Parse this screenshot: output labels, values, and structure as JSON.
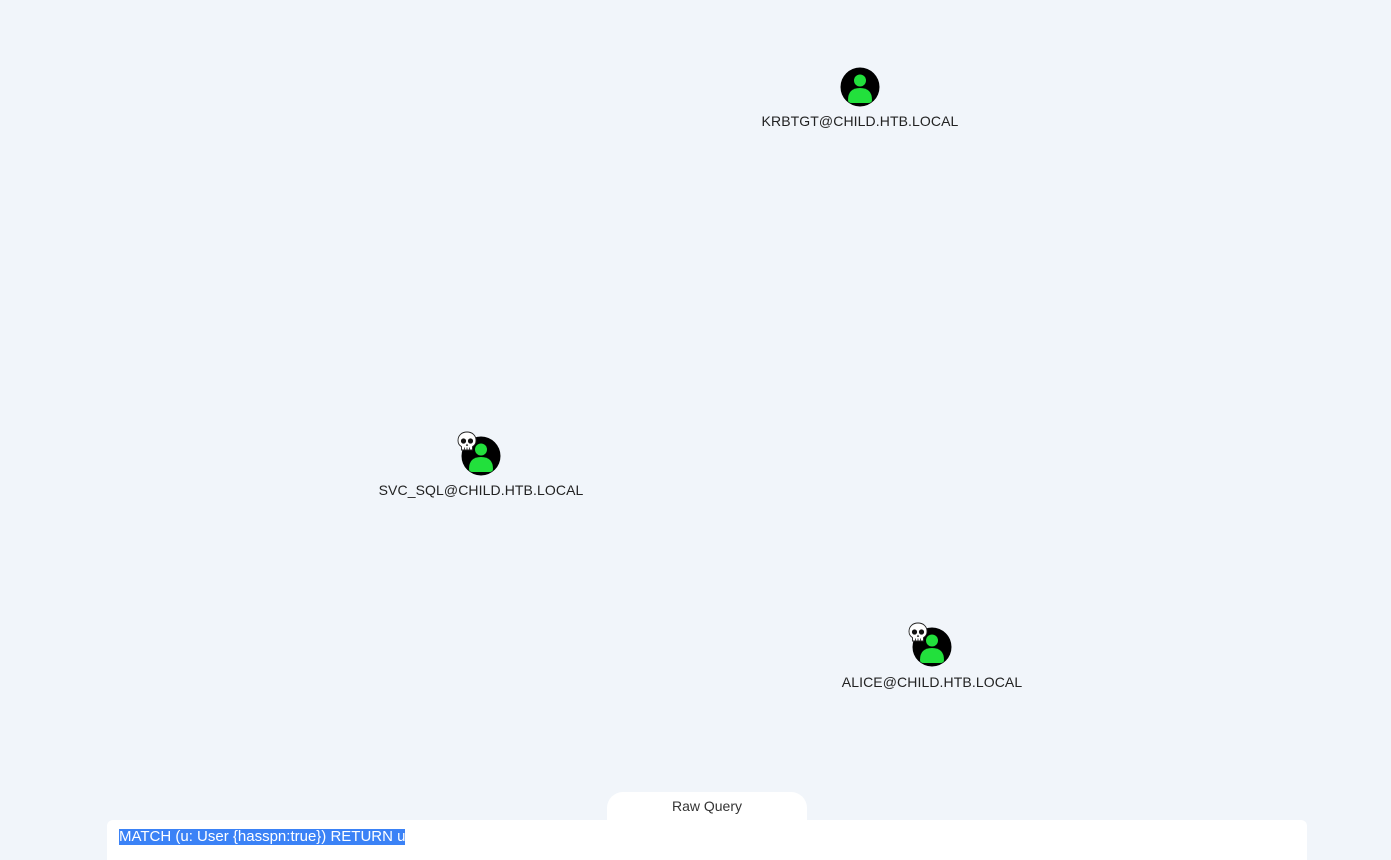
{
  "graph": {
    "nodes": [
      {
        "id": "krbtgt",
        "label": "KRBTGT@CHILD.HTB.LOCAL",
        "icon": "user-icon",
        "marked": false
      },
      {
        "id": "svc_sql",
        "label": "SVC_SQL@CHILD.HTB.LOCAL",
        "icon": "user-icon",
        "marked": true,
        "marker_icon": "skull-icon"
      },
      {
        "id": "alice",
        "label": "ALICE@CHILD.HTB.LOCAL",
        "icon": "user-icon",
        "marked": true,
        "marker_icon": "skull-icon"
      }
    ]
  },
  "query_panel": {
    "tab_label": "Raw Query",
    "query": "MATCH (u: User {hasspn:true}) RETURN u"
  },
  "colors": {
    "background": "#f1f5fa",
    "node_fill": "#000000",
    "node_person": "#22e03c",
    "selection": "#3b82f6"
  }
}
